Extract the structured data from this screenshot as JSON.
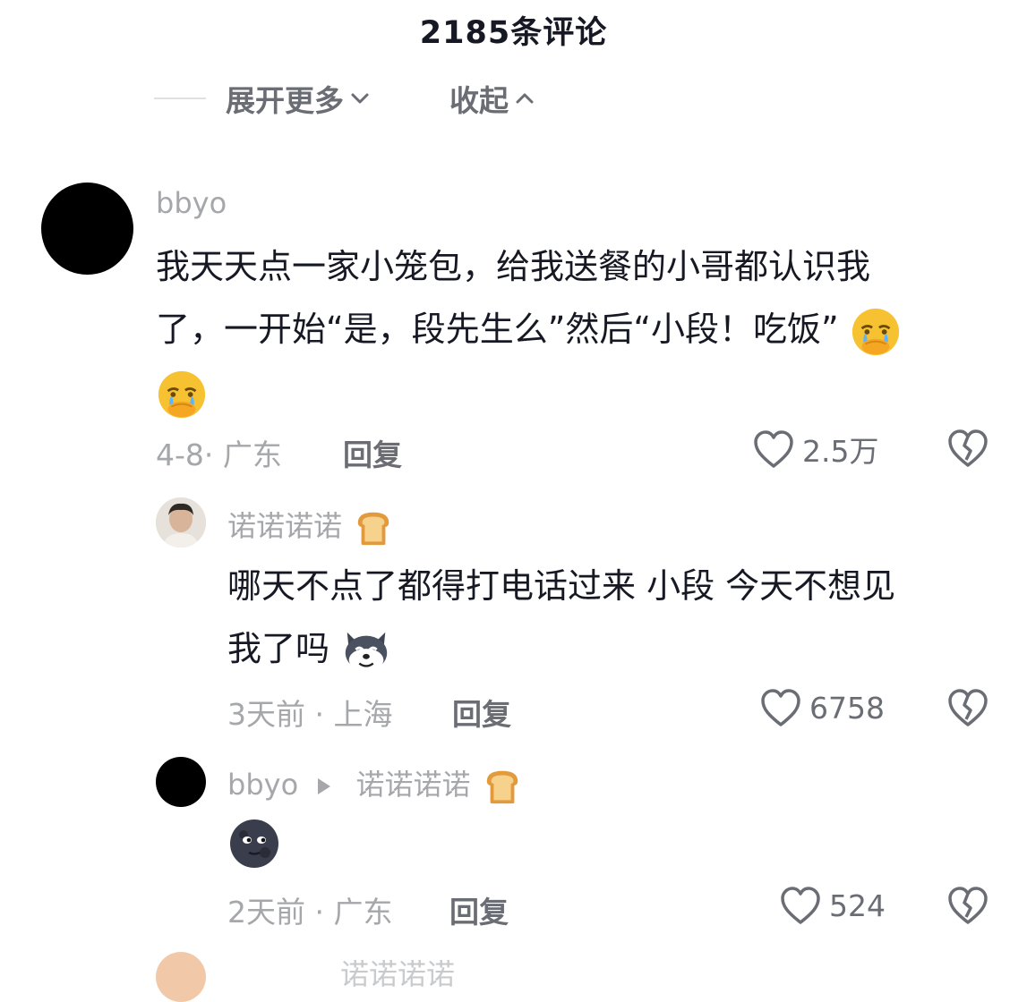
{
  "header": {
    "title": "2185条评论"
  },
  "controls": {
    "expand_label": "展开更多",
    "collapse_label": "收起"
  },
  "comments": [
    {
      "user": "bbyo",
      "text_line1": "我天天点一家小笼包，给我送餐的小哥都认识我",
      "text_line2": "了，一开始“是，段先生么”然后“小段！吃饭”",
      "emojis": [
        "crying-face-emoji",
        "crying-face-emoji"
      ],
      "meta": "4-8· 广东",
      "reply_label": "回复",
      "likes": "2.5万"
    },
    {
      "user": "诺诺诺诺",
      "user_badge": "bread-emoji",
      "text_line1": "哪天不点了都得打电话过来 小段 今天不想见",
      "text_line2": "我了吗",
      "emojis": [
        "husky-emoji"
      ],
      "meta": "3天前 · 上海",
      "reply_label": "回复",
      "likes": "6758"
    },
    {
      "user": "bbyo",
      "reply_to": "诺诺诺诺",
      "user_badge": "bread-emoji",
      "emojis": [
        "new-moon-face-emoji"
      ],
      "meta": "2天前 · 广东",
      "reply_label": "回复",
      "likes": "524"
    }
  ],
  "partial_next": {
    "user_fragment": "诺诺诺诺"
  },
  "colors": {
    "text_primary": "#161823",
    "text_secondary": "#a6a7ab",
    "text_action": "#6b6d74",
    "divider": "#e0e0e3"
  }
}
